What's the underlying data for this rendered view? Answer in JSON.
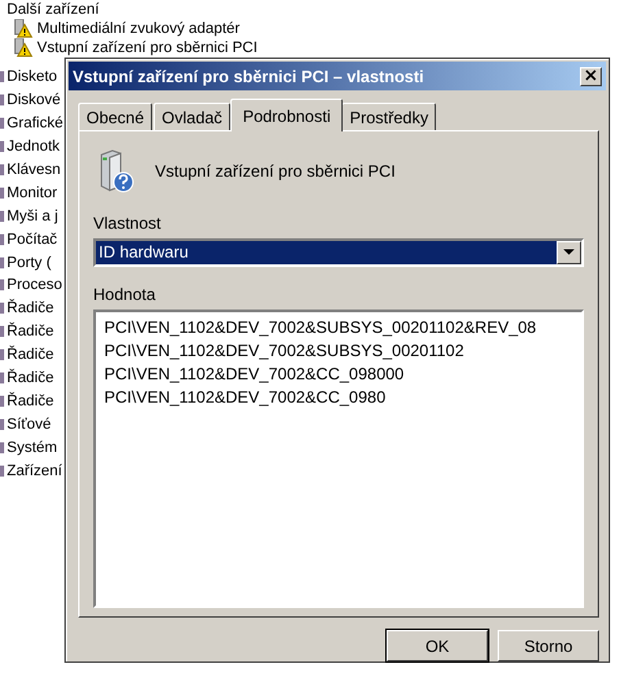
{
  "device_tree": {
    "category": "Další zařízení",
    "children": [
      {
        "label": "Multimediální zvukový adaptér",
        "warning": true
      },
      {
        "label": "Vstupní zařízení pro sběrnici PCI",
        "warning": true
      }
    ],
    "other_categories": [
      "Disketo",
      "Diskové",
      "Grafické",
      "Jednotk",
      "Klávesn",
      "Monitor",
      "Myši a j",
      "Počítač",
      "Porty (",
      "Proceso",
      "Řadiče",
      "Řadiče",
      "Řadiče",
      "Řadiče",
      "Řadiče",
      "Síťové",
      "Systém",
      "Zařízení"
    ]
  },
  "dialog": {
    "title": "Vstupní zařízení pro sběrnici PCI – vlastnosti",
    "close": "×",
    "tabs": [
      {
        "label": "Obecné",
        "selected": false
      },
      {
        "label": "Ovladač",
        "selected": false
      },
      {
        "label": "Podrobnosti",
        "selected": true
      },
      {
        "label": "Prostředky",
        "selected": false
      }
    ],
    "device_name": "Vstupní zařízení pro sběrnici PCI",
    "property_label": "Vlastnost",
    "property_value": "ID hardwaru",
    "value_label": "Hodnota",
    "values": [
      "PCI\\VEN_1102&DEV_7002&SUBSYS_00201102&REV_08",
      "PCI\\VEN_1102&DEV_7002&SUBSYS_00201102",
      "PCI\\VEN_1102&DEV_7002&CC_098000",
      "PCI\\VEN_1102&DEV_7002&CC_0980"
    ],
    "buttons": [
      {
        "label": "OK",
        "default": true
      },
      {
        "label": "Storno",
        "default": false
      }
    ]
  }
}
